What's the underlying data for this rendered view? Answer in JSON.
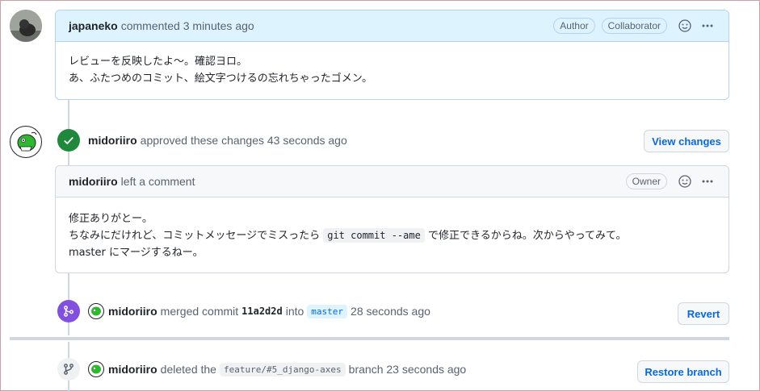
{
  "comment1": {
    "author": "japaneko",
    "meta": "commented 3 minutes ago",
    "labels": [
      "Author",
      "Collaborator"
    ],
    "body_lines": [
      "レビューを反映したよ〜。確認ヨロ。",
      "あ、ふたつめのコミット、絵文字つけるの忘れちゃったゴメン。"
    ]
  },
  "approval": {
    "author": "midoriiro",
    "text": "approved these changes 43 seconds ago",
    "button": "View changes"
  },
  "comment2": {
    "author": "midoriiro",
    "meta": "left a comment",
    "label": "Owner",
    "line1": "修正ありがとー。",
    "line2_before": "ちなみにだけれど、コミットメッセージでミスったら ",
    "line2_code": "git commit --ame",
    "line2_after": " で修正できるからね。次からやってみて。",
    "line3": "master にマージするねー。"
  },
  "merge": {
    "author": "midoriiro",
    "text1": "merged commit",
    "sha": "11a2d2d",
    "text2": "into",
    "branch": "master",
    "time": "28 seconds ago",
    "button": "Revert"
  },
  "deleted": {
    "author": "midoriiro",
    "text1": "deleted the",
    "branch": "feature/#5_django-axes",
    "text2": "branch 23 seconds ago",
    "button": "Restore branch"
  },
  "colors": {
    "approved": "#1f883d",
    "merged": "#8250df",
    "link": "#0969da"
  }
}
